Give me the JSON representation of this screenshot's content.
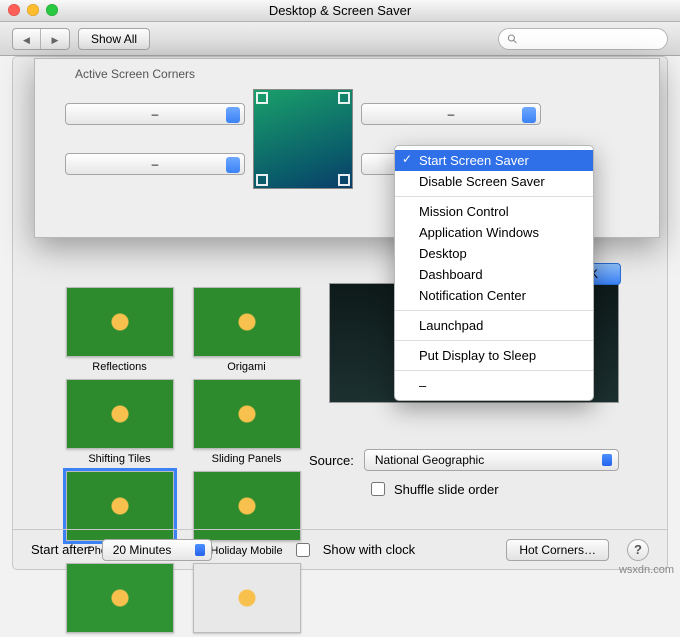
{
  "window": {
    "title": "Desktop & Screen Saver"
  },
  "toolbar": {
    "show_all": "Show All",
    "search_placeholder": ""
  },
  "ok_label": "OK",
  "screensavers": [
    {
      "label": "Reflections"
    },
    {
      "label": "Origami"
    },
    {
      "label": "Shifting Tiles"
    },
    {
      "label": "Sliding Panels"
    },
    {
      "label": "Photo Mobile"
    },
    {
      "label": "Holiday Mobile"
    }
  ],
  "source": {
    "label": "Source:",
    "value": "National Geographic",
    "shuffle_label": "Shuffle slide order"
  },
  "bottom": {
    "start_after_label": "Start after:",
    "start_after_value": "20 Minutes",
    "show_clock_label": "Show with clock",
    "hot_corners_label": "Hot Corners…"
  },
  "sheet": {
    "title": "Active Screen Corners",
    "tl": "–",
    "tr": "–",
    "bl": "–",
    "br": "Start Screen Saver"
  },
  "menu": {
    "items": [
      "Start Screen Saver",
      "Disable Screen Saver",
      "Mission Control",
      "Application Windows",
      "Desktop",
      "Dashboard",
      "Notification Center",
      "Launchpad",
      "Put Display to Sleep",
      "–"
    ],
    "dividers_before": [
      2,
      7,
      8,
      9
    ]
  },
  "watermark": "wsxdn.com"
}
